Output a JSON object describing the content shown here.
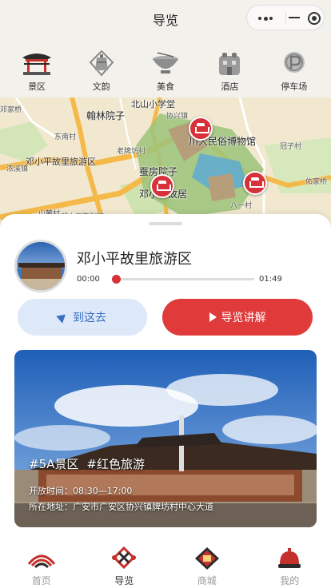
{
  "header": {
    "title": "导览"
  },
  "categories": [
    {
      "label": "景区",
      "icon": "pavilion-icon"
    },
    {
      "label": "文韵",
      "icon": "bell-icon"
    },
    {
      "label": "美食",
      "icon": "bowl-icon"
    },
    {
      "label": "酒店",
      "icon": "hotel-icon"
    },
    {
      "label": "停车场",
      "icon": "parking-icon"
    }
  ],
  "map": {
    "labels": [
      "邓家桥",
      "翰林院子",
      "东南村",
      "老牌坊村",
      "蚕房院子",
      "邓小平故里旅游区",
      "浓溪镇",
      "川大民俗博物馆",
      "冠子村",
      "佑家桥",
      "邓小平故居",
      "山麓村",
      "北山小学堂",
      "协兴镇",
      "八一村",
      "邓小平陈列馆"
    ]
  },
  "player": {
    "title": "邓小平故里旅游区",
    "current_time": "00:00",
    "total_time": "01:49",
    "progress": 0.02
  },
  "actions": {
    "go_label": "到这去",
    "guide_label": "导览讲解"
  },
  "photo": {
    "tags": [
      "#5A景区",
      "#红色旅游"
    ],
    "hours": "开放时间：08:30—17:00",
    "address": "所在地址：广安市广安区协兴镇牌坊村中心大道"
  },
  "tabbar": [
    {
      "label": "首页",
      "icon": "home-wave-icon",
      "active": false
    },
    {
      "label": "导览",
      "icon": "knot-icon",
      "active": true
    },
    {
      "label": "商城",
      "icon": "shop-icon",
      "active": false
    },
    {
      "label": "我的",
      "icon": "hat-icon",
      "active": false
    }
  ],
  "colors": {
    "accent": "#e03a3a",
    "go_bg": "#dde8f8",
    "go_text": "#3a6fc4"
  }
}
